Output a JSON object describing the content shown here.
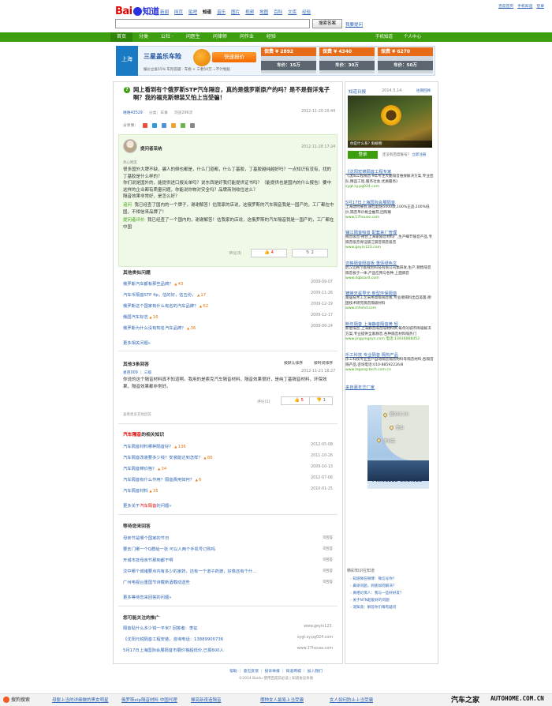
{
  "logo": {
    "a": "Bai",
    "b": "知道"
  },
  "topnav": [
    "新闻",
    "网页",
    "贴吧",
    "知道",
    "音乐",
    "图片",
    "视频",
    "地图",
    "百科",
    "文库",
    "经验"
  ],
  "toplinks": [
    "百度首页",
    "手机知道",
    "登录"
  ],
  "search": {
    "button": "搜索答案",
    "ask": "我要提问"
  },
  "gnav": {
    "items": [
      "首页",
      "分类",
      "公社 ·",
      "问医生",
      "问律师",
      "问作业",
      "经验"
    ],
    "right": [
      "手机知道",
      "个人中心"
    ]
  },
  "banner": {
    "city": "上海",
    "title": "三星盖乐车险",
    "sub": "报价立省15%   车险答疑 · 车损 + 三者50万 =不计免赔",
    "quote_btn": "快速报价",
    "deals": [
      {
        "save": "保费 ¥ 2892",
        "car": "车价：15万"
      },
      {
        "save": "保费 ¥ 4340",
        "car": "车价：30万"
      },
      {
        "save": "保费 ¥ 6270",
        "car": "车价：50万"
      }
    ]
  },
  "question": {
    "title": "网上看到有个俄罗斯STP汽车隔音，真的是俄罗斯原产的吗？是不是假洋鬼子啊？我的福克斯想装又怕上当受骗！",
    "user": "嘻嘻43529",
    "category": "分类：车事",
    "views": "浏览296次",
    "time": "2012-11-20 20:44",
    "share_label": "分享到："
  },
  "best": {
    "asker": "提问者采纳",
    "time": "2012-11-28 17:24",
    "cat": "热心网友",
    "lines": [
      "很多国外大牌不缺，骗人的倒也都是，什么门道都，什么丁基胶，丁基胶越纯越好吗？一点知识有没有，找的丁基胶是什么样的？",
      "你们说是国外的，能提供进口报关单吗？说东西是好我们能提供证书吗？（能提供也是国内的什么报告）要中这样的企业都有质量问题，你能说你物对安全吗？品牌商则收住这么？",
      "隔音效果非常好，是怎么好？"
    ],
    "follow": [
      {
        "tag": "追问",
        "text": "我已经查了国内的一个牌子，谢谢解答！估我家的店说，这俄罗斯的汽车隔音我是一国产的，工厂都在中国，不相信来品牌了！"
      },
      {
        "tag": "提问者评价",
        "text": "我已经查了一个国内的，谢谢解答！估我家的店说，这俄罗斯的汽车隔音我是一国产的，工厂都在中国"
      }
    ],
    "rate": "评论(3)",
    "up": "4",
    "down": "2"
  },
  "related": {
    "title": "其他类似问题",
    "rows": [
      {
        "t": "俄罗斯汽车都有那些品牌？",
        "n": "43",
        "d": "2009-09-07"
      },
      {
        "t": "汽车币隔音STP 4p，估的好，估五份，",
        "n": "17",
        "d": "2009-11-26"
      },
      {
        "t": "俄罗斯这个国家有什么有名的汽车品牌？",
        "n": "62",
        "d": "2009-12-19"
      },
      {
        "t": "俄国汽车标志",
        "n": "16",
        "d": "2009-12-17"
      },
      {
        "t": "俄罗斯为什么没有知名汽车品牌？",
        "n": "36",
        "d": "2009-06-24"
      }
    ],
    "more": "更多相关问题»"
  },
  "others": {
    "title": "其他3条回答",
    "tabs": [
      "按默认排序",
      "按时间排序"
    ],
    "user": "星芭009 ｜ 三级",
    "time": "2012-11-21 16:27",
    "body": "你说的这个隔音材料真不知道啊。我用的是索克汽车隔音材料，隔音效果很好，是纯丁基隔音材料，环保效果，隔音效果都非常好。",
    "rate": "评论(1)",
    "up": "5",
    "down": "1",
    "more": "查看更多其他回答"
  },
  "knowledge": {
    "title_red": "汽车隔音",
    "title_rest": "的相关知识",
    "rows": [
      {
        "t": "汽车隔音材料哪种隔音好？",
        "n": "136",
        "d": "2012-05-08"
      },
      {
        "t": "汽车隔音改装要多少钱？安装能达到怎样？",
        "n": "88",
        "d": "2011-10-26"
      },
      {
        "t": "汽车隔音棉价格？",
        "n": "34",
        "d": "2009-10-13"
      },
      {
        "t": "汽车隔音有什么作用？隔音费用如何？",
        "n": "6",
        "d": "2012-07-06"
      },
      {
        "t": "汽车隔音材料",
        "n": "35",
        "d": "2010-01-25"
      }
    ],
    "more_prefix": "更多关于",
    "more_red": "汽车隔音",
    "more_suffix": "的问题»"
  },
  "waiting": {
    "title": "等待您来回答",
    "rows": [
      {
        "t": "母亲节是哪个国家的节日",
        "d": "0回答"
      },
      {
        "t": "要去门哪一个Q群给一张 可以人两个手机号订购吗",
        "d": "0回答"
      },
      {
        "t": "开城市技母亲节那到都干啊",
        "d": "0回答"
      },
      {
        "t": "汶中哪个城诸要点内有多少的家药，还有一个道子药渡，好像还有个什…",
        "d": "0回答"
      },
      {
        "t": "广州电视台重国节诗载新酒载动送些",
        "d": "0回答"
      }
    ],
    "more": "更多等待您来回答的问题»"
  },
  "promo": {
    "title": "您可能关注的推广",
    "rows": [
      {
        "t": "隔音贴什么多少钱一平米?   回答者：李征",
        "u": "www.geyin123."
      },
      {
        "t": "《沈阳元锐隔音工程安装，咨询电话：13889900736",
        "u": "sygt.sy.pg024.com"
      },
      {
        "t": "5月17日上海国际会展隔音市展价格超低价,已报600人",
        "u": "www.17house.com"
      }
    ]
  },
  "side": {
    "head": "知道日报",
    "date": "2014.5.14",
    "more": "往期回顾",
    "pic_caption": "你是什么系？鲜植物",
    "login": "登录",
    "login_txt_a": "还没有百度账号？",
    "login_txt_b": "立即注册",
    "ads": [
      {
        "t": "《沈阳宏锦隔音工程专家",
        "b": "《沈阳工程隔音·9年专注大厦隔音维保解决方案,专业团队,精品工程,服务社会,优质服务》",
        "u": "sygt.sy.pg024.com"
      },
      {
        "t": "5月17日上海国际会展隔音",
        "b": "上海建材展会,展位超值5000款,100%正品,100%低价,隔音吊价格全推荐,团购联",
        "u": "www.17house.com"
      },
      {
        "t": "铺江隔音吸音 配套来厂管理",
        "b": "隔音吸音·德合上海家隔音材料厂,生产细节隔音产品,专隔音吸音保证铺江隔音隔音吸音",
        "u": "www.geyin123.com"
      },
      {
        "t": "迈格隔音隔音板 重惩绿色文",
        "b": "武汉迈格节能规划科技有限公司集研发,生产,销售隔音隔音板于一体,产品应用与各种,上面隔音",
        "u": "www.dqboard.com"
      },
      {
        "t": "镀烯天星导光 新型环保隔音",
        "b": "富居技术工艺采用高级隔音板,专业顺隔料出自美国,德国技术研究隔音隔级材料",
        "u": "www.mhshd.com"
      },
      {
        "t": "新年隔音 上海静音隔音黄 轻",
        "b": "新星隔音,上海静音隔音隔材料供,每年的城市降噪解决方案,专业提供全家静音,各种隔音材料隔热门",
        "u": "www.jingyingsyn.com 电话:13916068452"
      },
      {
        "t": "乐工科技 专业隔音 隔热产品",
        "b": "乐工科技专业生产自动隔音隔热材料等隔音材料,各隔音隔产品,咨询电话:010-88592226/8",
        "u": "www.legong-tech.com.cn"
      }
    ],
    "cruise_title": "来自嘉年华厂家",
    "map_labels": [
      "首尔(仁川)",
      "釜山",
      "济州岛"
    ],
    "cruise_brand": "PRINCESS CRUISES",
    "know_title": "精彩知识在知道",
    "know": [
      "知道微在微博：微信号你？",
      "鼻梁问题，到底如何解决？",
      "真相论情人：我与一些好好友？",
      "关于NTN超能好的问题",
      "宠知道：解答你们每有疑问"
    ]
  },
  "footer": {
    "links": "帮助 ｜ 意见反馈 ｜ 投诉举报 ｜ 知道商城 ｜ 加入我们",
    "copy": "©2014 Baidu  使用百度前必读 | 知道协议条款"
  },
  "bottom": {
    "sogou": "搜狗搜索",
    "links": [
      "母婴上当的详细做的黑女明星",
      "俄罗斯stp隔音材料 中国代理",
      "稀亮新夜造隔音",
      "哪种女人最易上当受骗",
      "女人如何防止上当受骗"
    ]
  },
  "watermark": {
    "cn": "汽车之家",
    "url": "AUTOHOME.COM.CN"
  }
}
